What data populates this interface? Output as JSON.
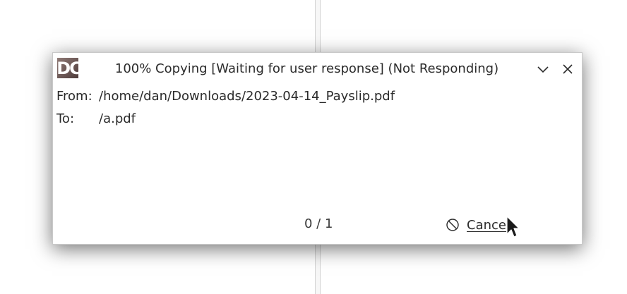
{
  "window": {
    "title": "100% Copying [Waiting for user response] (Not Responding)",
    "app_icon": "doublecmd-icon",
    "buttons": {
      "minimize": "chevron-down-icon",
      "close": "close-icon"
    }
  },
  "transfer": {
    "from_label": "From:",
    "from_path": "/home/dan/Downloads/2023-04-14_Payslip.pdf",
    "to_label": "To:",
    "to_path": "/a.pdf",
    "progress": "0 / 1"
  },
  "actions": {
    "cancel_label": "Cance",
    "cancel_icon": "cancel-icon"
  }
}
